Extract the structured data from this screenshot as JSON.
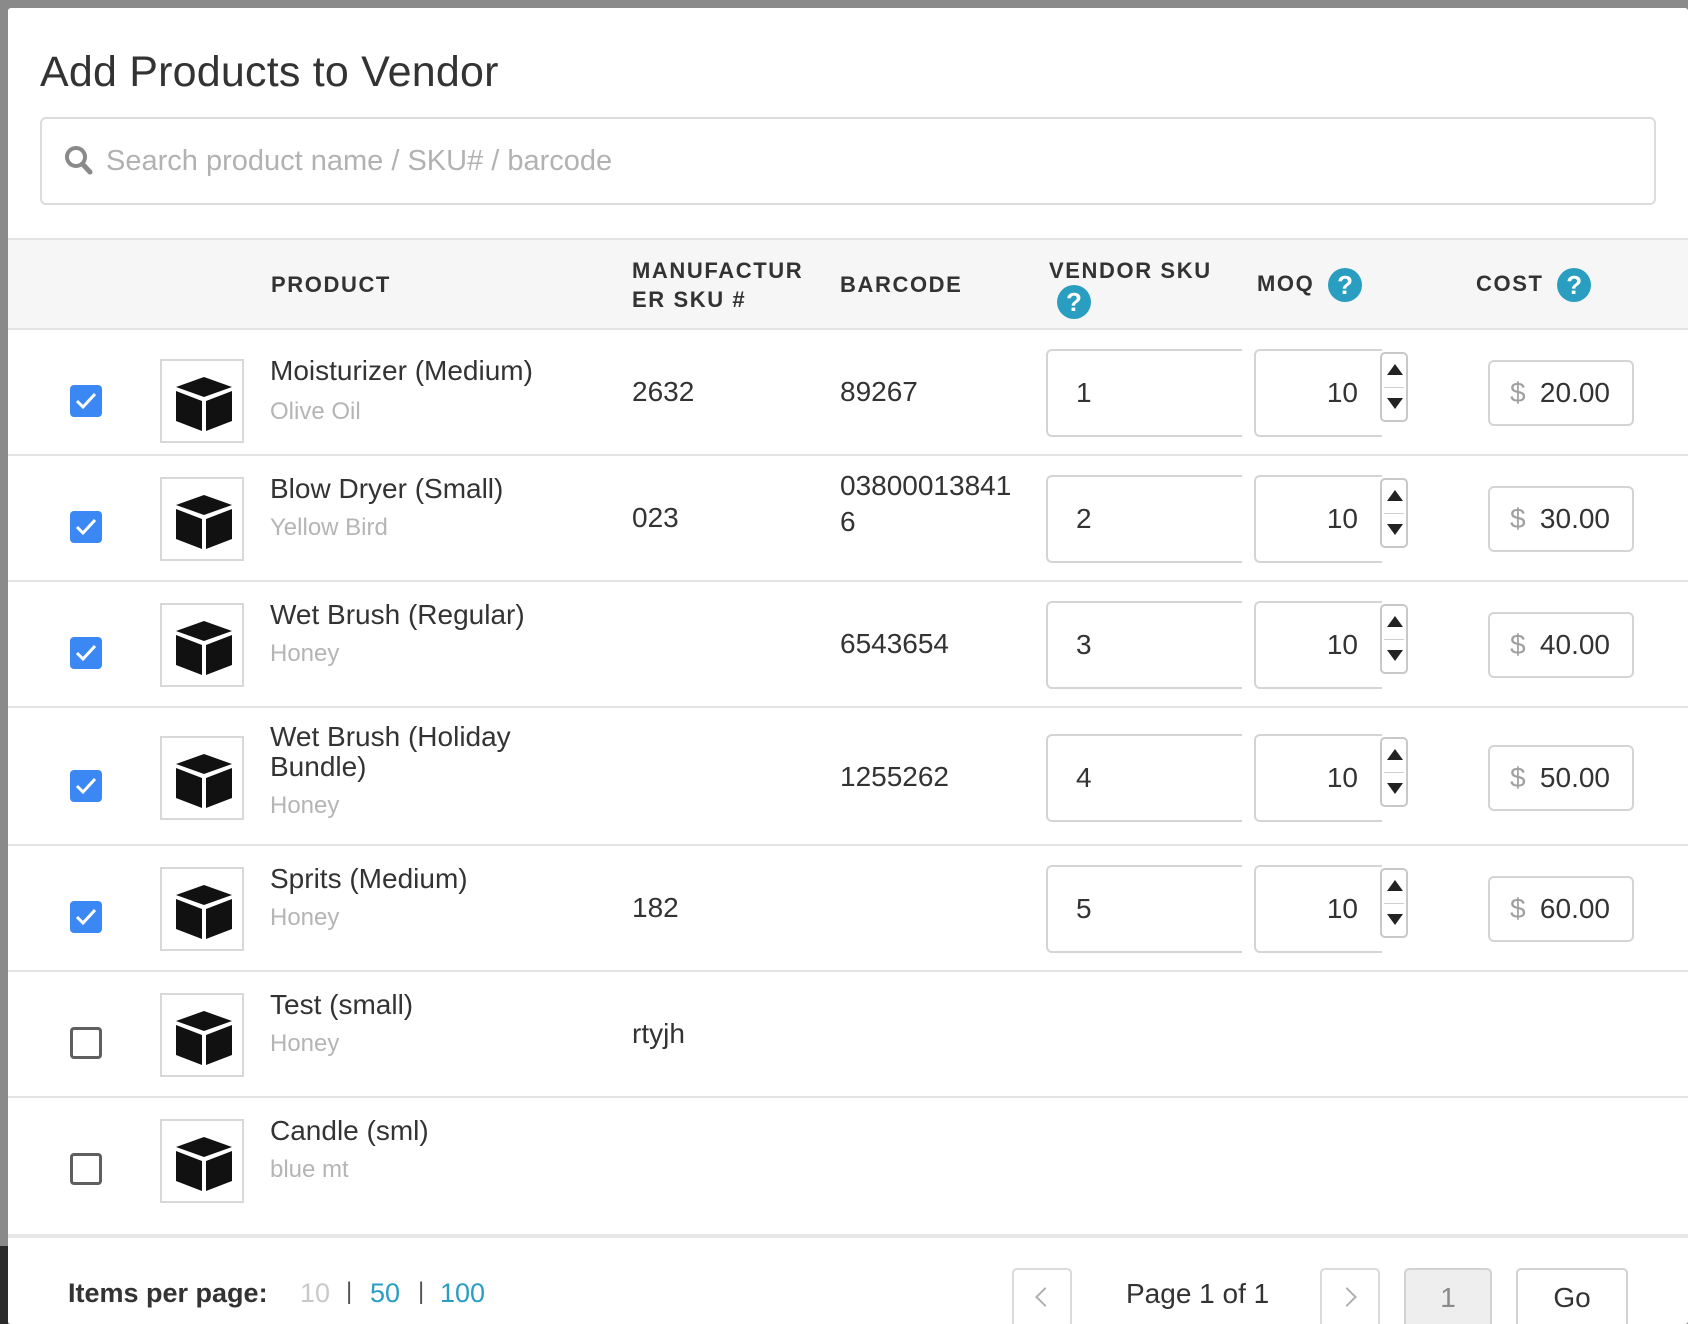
{
  "dialog": {
    "title": "Add Products to Vendor"
  },
  "search": {
    "placeholder": "Search product name / SKU# / barcode",
    "value": ""
  },
  "columns": {
    "product": "PRODUCT",
    "manufacturer_sku_line1": "MANUFACTUR",
    "manufacturer_sku_line2": "ER SKU #",
    "barcode": "BARCODE",
    "vendor_sku": "VENDOR SKU",
    "moq": "MOQ",
    "cost": "COST",
    "help_glyph": "?"
  },
  "currency_symbol": "$",
  "rows": [
    {
      "checked": true,
      "name": "Moisturizer (Medium)",
      "variant": "Olive Oil",
      "manufacturer_sku": "2632",
      "barcode_line1": "89267",
      "barcode_line2": "",
      "vendor_sku": "1",
      "moq": "10",
      "cost": "20.00"
    },
    {
      "checked": true,
      "name": "Blow Dryer (Small)",
      "variant": "Yellow Bird",
      "manufacturer_sku": "023",
      "barcode_line1": "03800013841",
      "barcode_line2": "6",
      "vendor_sku": "2",
      "moq": "10",
      "cost": "30.00"
    },
    {
      "checked": true,
      "name": "Wet Brush (Regular)",
      "variant": "Honey",
      "manufacturer_sku": "",
      "barcode_line1": "6543654",
      "barcode_line2": "",
      "vendor_sku": "3",
      "moq": "10",
      "cost": "40.00"
    },
    {
      "checked": true,
      "name_line1": "Wet Brush (Holiday",
      "name_line2": "Bundle)",
      "variant": "Honey",
      "manufacturer_sku": "",
      "barcode_line1": "1255262",
      "barcode_line2": "",
      "vendor_sku": "4",
      "moq": "10",
      "cost": "50.00"
    },
    {
      "checked": true,
      "name": "Sprits (Medium)",
      "variant": "Honey",
      "manufacturer_sku": "182",
      "barcode_line1": "",
      "barcode_line2": "",
      "vendor_sku": "5",
      "moq": "10",
      "cost": "60.00"
    },
    {
      "checked": false,
      "name": "Test (small)",
      "variant": "Honey",
      "manufacturer_sku": "rtyjh",
      "barcode_line1": "",
      "barcode_line2": "",
      "vendor_sku": "",
      "moq": "",
      "cost": ""
    },
    {
      "checked": false,
      "name": "Candle (sml)",
      "variant": "blue mt",
      "manufacturer_sku": "",
      "barcode_line1": "",
      "barcode_line2": "",
      "vendor_sku": "",
      "moq": "",
      "cost": ""
    }
  ],
  "footer": {
    "items_per_page_label": "Items per page:",
    "per_page_options": [
      "10",
      "50",
      "100"
    ],
    "per_page_separator": "|",
    "selected_per_page": "10",
    "page_info": "Page 1 of 1",
    "page_input_value": "1",
    "go_label": "Go"
  },
  "colors": {
    "accent": "#2a9ec0",
    "checkbox_checked": "#3b88f5"
  }
}
